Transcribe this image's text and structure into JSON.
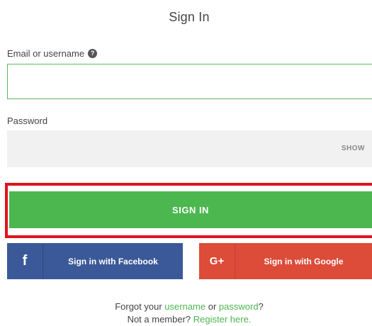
{
  "page": {
    "title": "Sign In"
  },
  "form": {
    "email": {
      "label": "Email or username",
      "help_icon": "question-circle-icon",
      "help_glyph": "?",
      "value": "",
      "placeholder": ""
    },
    "password": {
      "label": "Password",
      "value": "",
      "placeholder": "",
      "toggle_label": "SHOW"
    },
    "submit_label": "SIGN IN"
  },
  "social": {
    "facebook": {
      "icon": "facebook-icon",
      "glyph": "f",
      "label": "Sign in with Facebook"
    },
    "google": {
      "icon": "google-plus-icon",
      "glyph": "G+",
      "label": "Sign in with Google"
    }
  },
  "footer": {
    "forgot_prefix": "Forgot your ",
    "username_link": "username",
    "or_text": " or ",
    "password_link": "password",
    "forgot_suffix": "?",
    "not_member": "Not a member? ",
    "register_link": "Register here."
  },
  "colors": {
    "accent_green": "#4cb74f",
    "highlight_red": "#e0131e",
    "facebook_blue": "#3b5998",
    "google_red": "#dd4b39"
  }
}
